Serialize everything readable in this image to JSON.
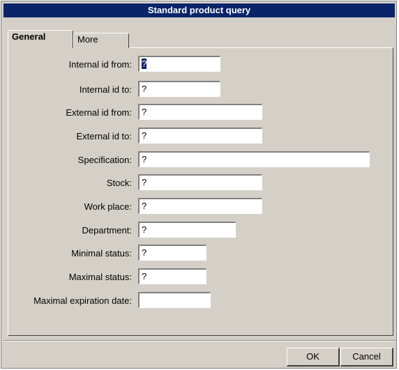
{
  "window": {
    "title": "Standard product query"
  },
  "tabs": [
    {
      "label": "General",
      "active": true
    },
    {
      "label": "More",
      "active": false
    }
  ],
  "fields": [
    {
      "label": "Internal id from:",
      "value": "?"
    },
    {
      "label": "Internal id to:",
      "value": "?"
    },
    {
      "label": "External id from:",
      "value": "?"
    },
    {
      "label": "External id to:",
      "value": "?"
    },
    {
      "label": "Specification:",
      "value": "?"
    },
    {
      "label": "Stock:",
      "value": "?"
    },
    {
      "label": "Work place:",
      "value": "?"
    },
    {
      "label": "Department:",
      "value": "?"
    },
    {
      "label": "Minimal status:",
      "value": "?"
    },
    {
      "label": "Maximal status:",
      "value": "?"
    },
    {
      "label": "Maximal expiration date:",
      "value": ""
    }
  ],
  "buttons": {
    "ok": "OK",
    "cancel": "Cancel"
  },
  "colors": {
    "titlebar": "#0a246a",
    "face": "#d4d0c8"
  }
}
